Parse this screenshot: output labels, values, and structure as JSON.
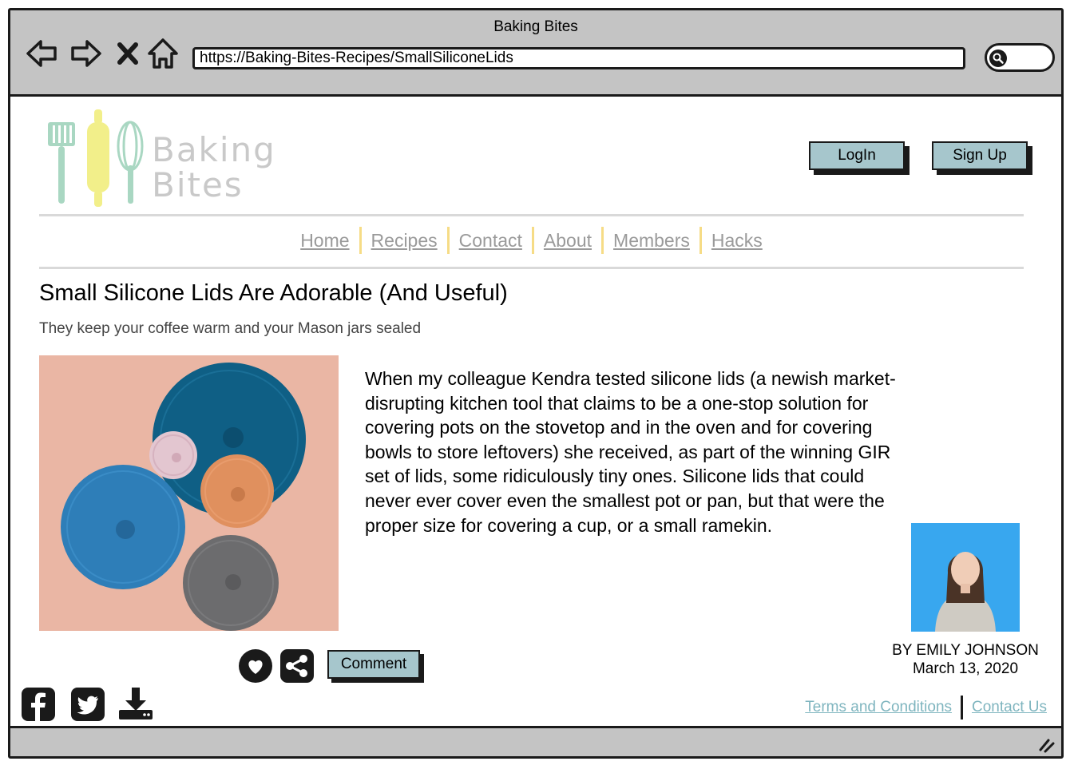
{
  "browser": {
    "window_title": "Baking Bites",
    "url": "https://Baking-Bites-Recipes/SmallSiliconeLids",
    "nav_icons": [
      "back-icon",
      "forward-icon",
      "close-icon",
      "home-icon"
    ],
    "search_icon": "search-icon"
  },
  "header": {
    "logo_line_1": "Baking",
    "logo_line_2": "Bites",
    "login_label": "LogIn",
    "signup_label": "Sign Up"
  },
  "nav": {
    "items": [
      "Home",
      "Recipes",
      "Contact",
      "About",
      "Members",
      "Hacks"
    ]
  },
  "article": {
    "title": "Small Silicone Lids Are Adorable (And Useful)",
    "subtitle": "They keep your coffee warm and your Mason jars sealed",
    "body": "When my colleague Kendra tested silicone lids (a newish market-disrupting kitchen tool that claims to be a one-stop solution for covering pots on the stovetop and in the oven and for covering bowls to store leftovers) she received, as part of the winning GIR set of lids, some ridiculously tiny ones. Silicone lids that could never ever cover even the smallest pot or pan, but that were the proper size for covering a cup, or a small ramekin.",
    "author": "BY EMILY JOHNSON",
    "date": "March 13, 2020"
  },
  "actions": {
    "like_icon": "heart-icon",
    "share_icon": "share-icon",
    "comment_label": "Comment"
  },
  "social": {
    "icons": [
      "facebook-icon",
      "twitter-icon",
      "download-icon"
    ]
  },
  "footer": {
    "terms_label": "Terms and Conditions",
    "contact_label": "Contact Us"
  },
  "colors": {
    "chrome": "#c4c4c4",
    "button": "#a6c6cc",
    "nav_link": "#9a9a9a",
    "nav_separator": "#f6dc86",
    "footer_link": "#7fb5bf",
    "image_background": "#eab6a4",
    "photo_background": "#38a7ef"
  }
}
